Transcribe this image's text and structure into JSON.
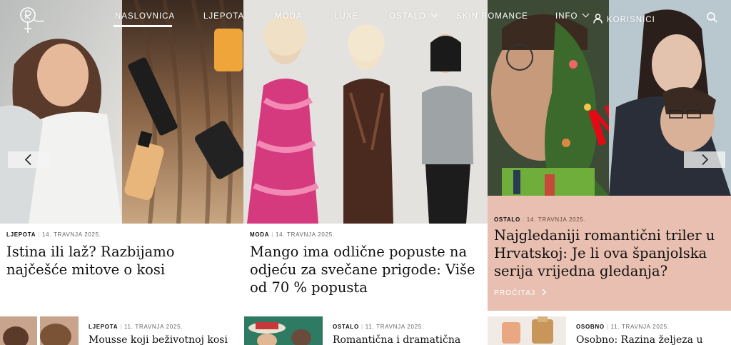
{
  "nav": {
    "items": [
      "NASLOVNICA",
      "LJEPOTA",
      "MODA",
      "LUXE",
      "OSTALO",
      "SKIN ROMANCE",
      "INFO",
      "KORISNICI"
    ]
  },
  "colors": {
    "accent_bg": "#e8bfb0",
    "text": "#111111",
    "nav_text": "#ffffff"
  },
  "icons": {
    "logo": "venus-logo-icon",
    "dropdown": "chevron-down-icon",
    "user": "user-icon",
    "search": "search-icon",
    "prev": "chevron-left-icon",
    "next": "chevron-right-icon",
    "read_more": "chevron-right-icon"
  },
  "carousel": {
    "slides": [
      {
        "category": "LJEPOTA",
        "date": "14. TRAVNJA 2025.",
        "title": "Istina ili laž? Razbijamo najčešće mitove o kosi"
      },
      {
        "category": "MODA",
        "date": "14. TRAVNJA 2025.",
        "title": "Mango ima odlične popuste na odjeću za svečane prigode: Više od 70 % popusta"
      },
      {
        "category": "OSTALO",
        "date": "14. TRAVNJA 2025.",
        "title": "Najgledaniji romantični triler u Hrvatskoj: Je li ova španjolska serija vrijedna gledanja?",
        "read_more": "PROČITAJ"
      }
    ]
  },
  "articles": [
    {
      "category": "LJEPOTA",
      "date": "11. TRAVNJA 2025.",
      "title": "Mousse koji beživotnoj kosi"
    },
    {
      "category": "OSTALO",
      "date": "11. TRAVNJA 2025.",
      "title": "Romantična i dramatična"
    },
    {
      "category": "OSOBNO",
      "date": "11. TRAVNJA 2025.",
      "title": "Osobno: Razina željeza u"
    }
  ]
}
